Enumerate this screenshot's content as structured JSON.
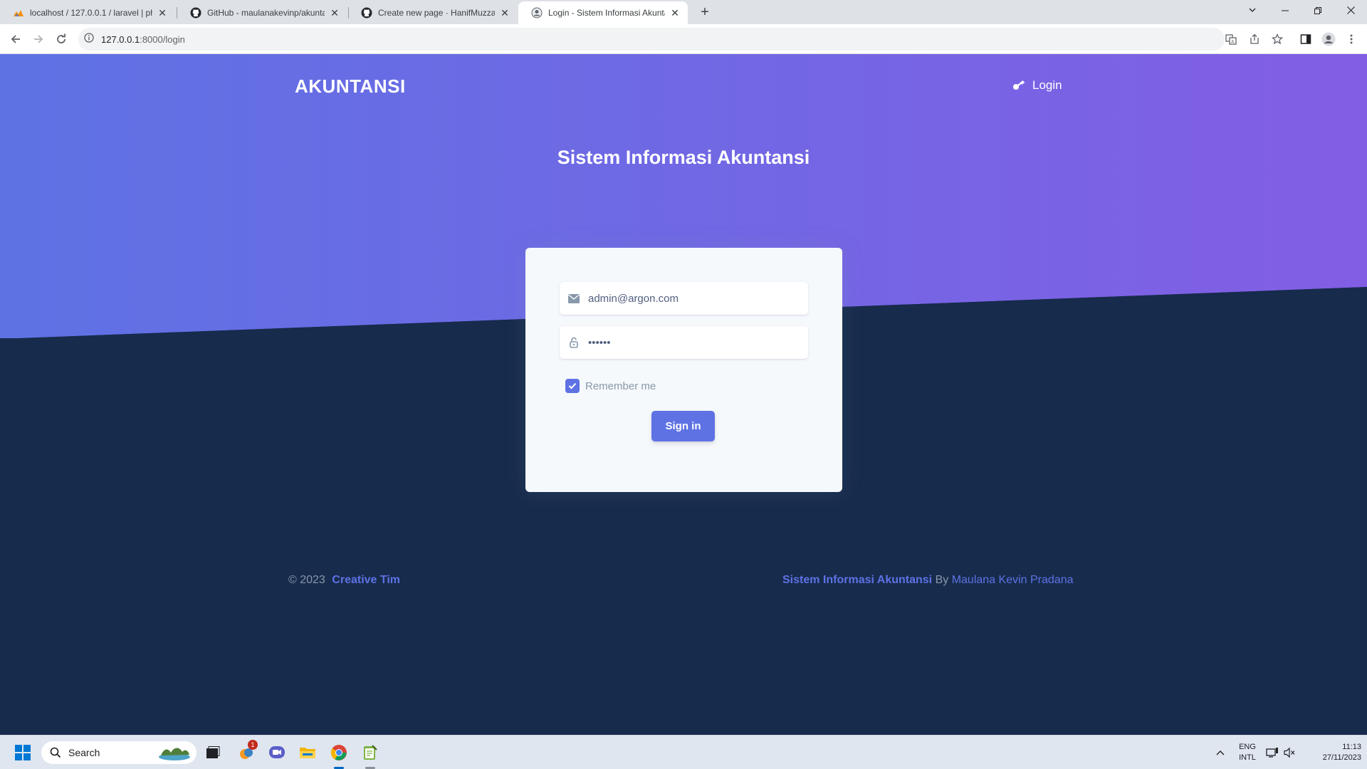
{
  "browser": {
    "tabs": [
      {
        "title": "localhost / 127.0.0.1 / laravel | ph",
        "icon": "phpmyadmin-icon"
      },
      {
        "title": "GitHub - maulanakevinp/akunta",
        "icon": "github-icon"
      },
      {
        "title": "Create new page · HanifMuzzaki",
        "icon": "github-icon"
      },
      {
        "title": "Login - Sistem Informasi Akunta",
        "icon": "site-icon"
      }
    ],
    "url_host": "127.0.0.1",
    "url_path": ":8000/login"
  },
  "page": {
    "brand": "AKUNTANSI",
    "nav_login": "Login",
    "headline": "Sistem Informasi Akuntansi",
    "form": {
      "email_value": "admin@argon.com",
      "password_value": "secret",
      "remember_label": "Remember me",
      "remember_checked": true,
      "submit_label": "Sign in"
    },
    "footer": {
      "copyright": "© 2023",
      "company": "Creative Tim",
      "app_name": "Sistem Informasi Akuntansi",
      "by": "By",
      "author": "Maulana Kevin Pradana"
    },
    "colors": {
      "primary": "#5e72e4",
      "gradient_end": "#825ee4",
      "dark_bg": "#172b4d"
    }
  },
  "taskbar": {
    "search_placeholder": "Search",
    "badge_count": "1",
    "lang_top": "ENG",
    "lang_bottom": "INTL",
    "time": "11:13",
    "date": "27/11/2023"
  }
}
